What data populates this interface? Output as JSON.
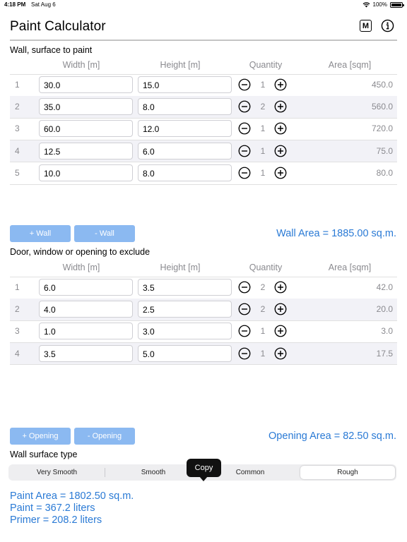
{
  "status": {
    "time": "4:18 PM",
    "date": "Sat Aug 6",
    "battery": "100%"
  },
  "header": {
    "title": "Paint Calculator",
    "menu_label": "M",
    "info_icon": "info-icon"
  },
  "walls": {
    "section_label": "Wall, surface to paint",
    "columns": {
      "width": "Width [m]",
      "height": "Height [m]",
      "quantity": "Quantity",
      "area": "Area [sqm]"
    },
    "rows": [
      {
        "num": "1",
        "width": "30.0",
        "height": "15.0",
        "qty": "1",
        "area": "450.0"
      },
      {
        "num": "2",
        "width": "35.0",
        "height": "8.0",
        "qty": "2",
        "area": "560.0"
      },
      {
        "num": "3",
        "width": "60.0",
        "height": "12.0",
        "qty": "1",
        "area": "720.0"
      },
      {
        "num": "4",
        "width": "12.5",
        "height": "6.0",
        "qty": "1",
        "area": "75.0"
      },
      {
        "num": "5",
        "width": "10.0",
        "height": "8.0",
        "qty": "1",
        "area": "80.0"
      }
    ],
    "add_label": "+ Wall",
    "remove_label": "- Wall",
    "total": "Wall Area = 1885.00 sq.m."
  },
  "openings": {
    "section_label": "Door, window or opening to exclude",
    "columns": {
      "width": "Width [m]",
      "height": "Height [m]",
      "quantity": "Quantity",
      "area": "Area [sqm]"
    },
    "rows": [
      {
        "num": "1",
        "width": "6.0",
        "height": "3.5",
        "qty": "2",
        "area": "42.0"
      },
      {
        "num": "2",
        "width": "4.0",
        "height": "2.5",
        "qty": "2",
        "area": "20.0"
      },
      {
        "num": "3",
        "width": "1.0",
        "height": "3.0",
        "qty": "1",
        "area": "3.0"
      },
      {
        "num": "4",
        "width": "3.5",
        "height": "5.0",
        "qty": "1",
        "area": "17.5"
      }
    ],
    "add_label": "+ Opening",
    "remove_label": "- Opening",
    "total": "Opening Area = 82.50 sq.m."
  },
  "surface": {
    "section_label": "Wall surface type",
    "options": [
      "Very Smooth",
      "Smooth",
      "Common",
      "Rough"
    ],
    "selected": "Rough"
  },
  "tooltip": {
    "label": "Copy"
  },
  "results": {
    "paint_area": "Paint Area = 1802.50 sq.m.",
    "paint": "Paint = 367.2 liters",
    "primer": "Primer = 208.2 liters"
  },
  "colors": {
    "accent": "#2a7ad5",
    "button": "#8bb9f1",
    "alt_row": "#f2f2f7"
  }
}
